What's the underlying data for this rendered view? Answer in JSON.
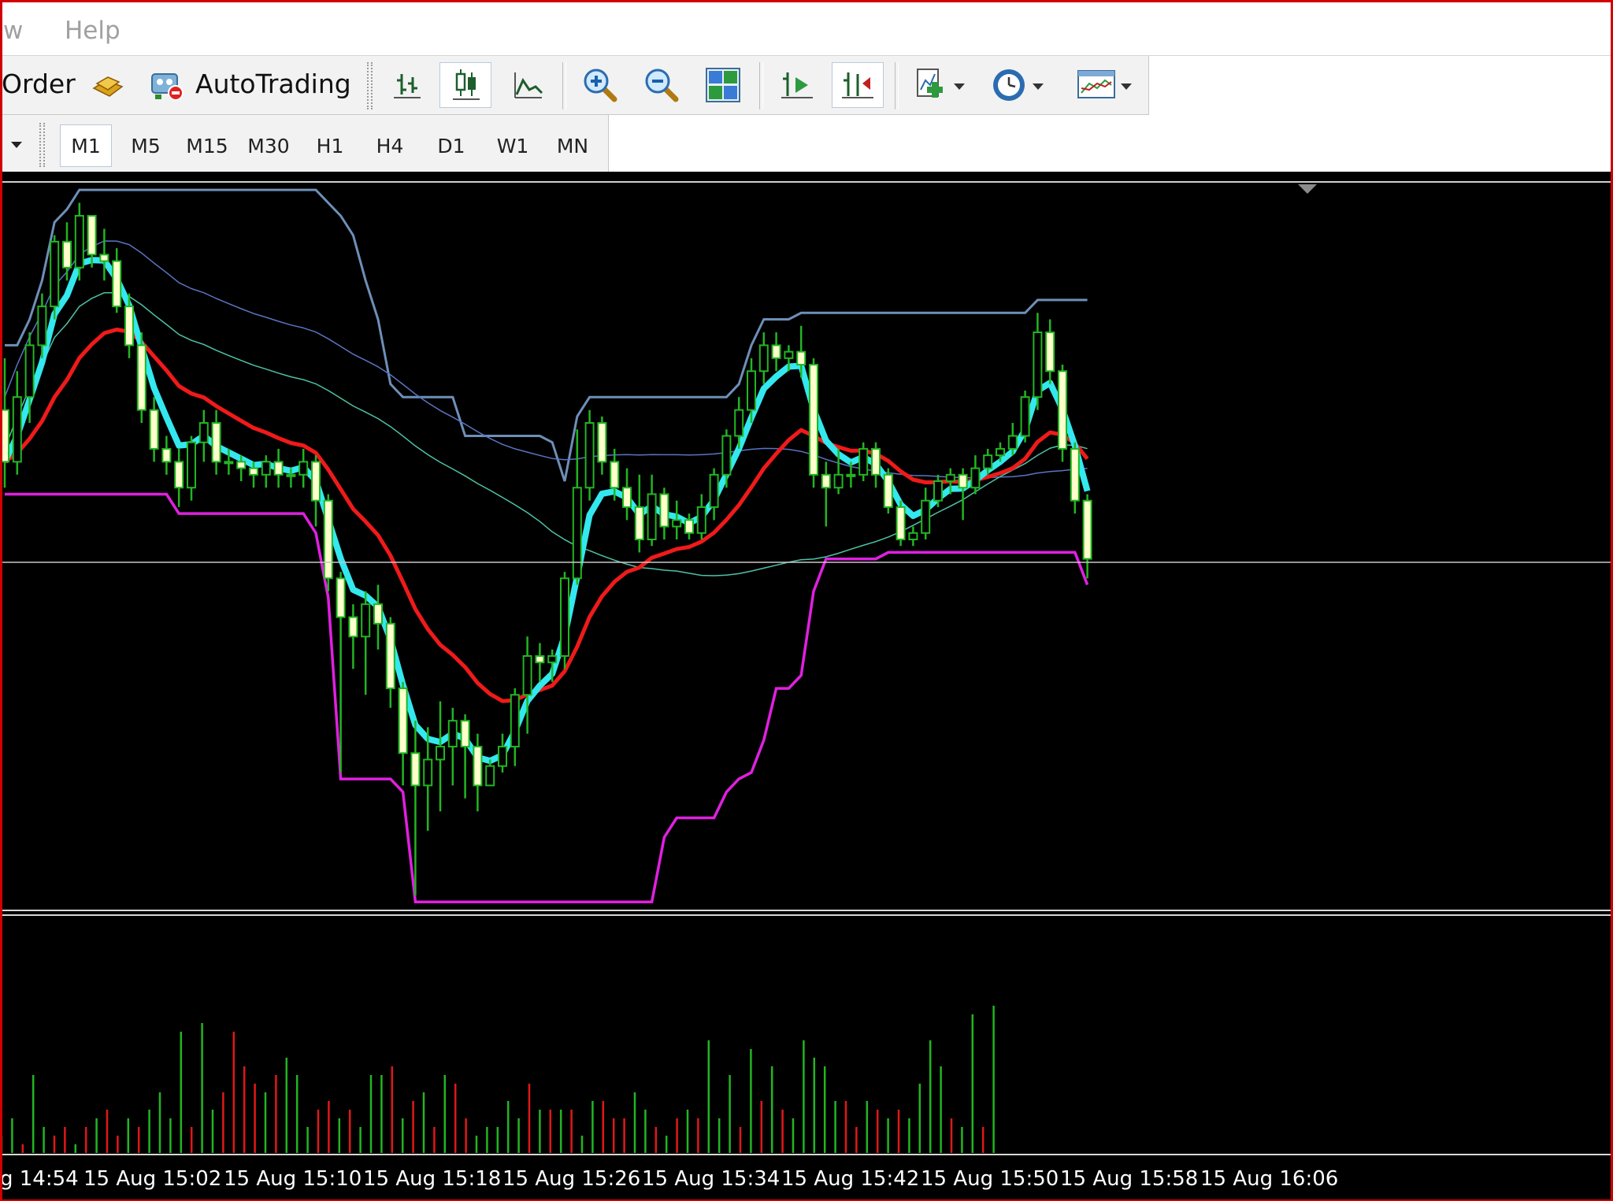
{
  "menu": {
    "items": [
      "w",
      "Help"
    ]
  },
  "toolbar": {
    "new_order_label": "Order",
    "autotrading_label": "AutoTrading"
  },
  "timeframes": [
    "M1",
    "M5",
    "M15",
    "M30",
    "H1",
    "H4",
    "D1",
    "W1",
    "MN"
  ],
  "active_timeframe": "M1",
  "icons": {
    "expert": "gold-bars-icon",
    "autotrading": "autotrading-icon",
    "bar_chart": "bar-chart-icon",
    "candlesticks": "candlesticks-icon",
    "line_chart": "line-chart-icon",
    "zoom_in": "zoom-in-icon",
    "zoom_out": "zoom-out-icon",
    "tile_windows": "tile-windows-icon",
    "autoscroll": "autoscroll-icon",
    "chart_shift": "chart-shift-icon",
    "indicators": "add-indicator-icon",
    "periods": "clock-icon",
    "templates": "templates-icon"
  },
  "colors": {
    "background": "#000000",
    "candle_body": "#ffffcc",
    "wick_and_volume_up": "#22b522",
    "volume_down": "#e01818",
    "ma_fast": "#33e8ee",
    "ma_slow": "#f01a1a",
    "upper_channel": "#6e8fb8",
    "lower_channel": "#e020e0",
    "mid_lines": "#5a74c2",
    "mid_lines_2": "#4fc2a6",
    "horizontal_line": "#c8c8c8"
  },
  "time_axis": {
    "labels": [
      "g 14:54",
      "15 Aug 15:02",
      "15 Aug 15:10",
      "15 Aug 15:18",
      "15 Aug 15:26",
      "15 Aug 15:34",
      "15 Aug 15:42",
      "15 Aug 15:50",
      "15 Aug 15:58",
      "15 Aug 16:06"
    ]
  },
  "series": {
    "candles_rel": [
      [
        0.7,
        0.62,
        0.78,
        0.58
      ],
      [
        0.62,
        0.72,
        0.76,
        0.6
      ],
      [
        0.72,
        0.8,
        0.82,
        0.68
      ],
      [
        0.8,
        0.86,
        0.88,
        0.78
      ],
      [
        0.86,
        0.96,
        0.97,
        0.84
      ],
      [
        0.96,
        0.92,
        0.99,
        0.9
      ],
      [
        0.92,
        1.0,
        1.02,
        0.9
      ],
      [
        1.0,
        0.94,
        1.0,
        0.92
      ],
      [
        0.94,
        0.93,
        0.98,
        0.9
      ],
      [
        0.93,
        0.86,
        0.95,
        0.85
      ],
      [
        0.86,
        0.8,
        0.88,
        0.78
      ],
      [
        0.8,
        0.7,
        0.82,
        0.68
      ],
      [
        0.7,
        0.64,
        0.72,
        0.62
      ],
      [
        0.64,
        0.62,
        0.66,
        0.6
      ],
      [
        0.62,
        0.58,
        0.64,
        0.55
      ],
      [
        0.58,
        0.65,
        0.66,
        0.56
      ],
      [
        0.65,
        0.68,
        0.7,
        0.62
      ],
      [
        0.68,
        0.62,
        0.7,
        0.6
      ],
      [
        0.62,
        0.62,
        0.64,
        0.6
      ],
      [
        0.62,
        0.61,
        0.63,
        0.59
      ],
      [
        0.61,
        0.6,
        0.62,
        0.58
      ],
      [
        0.6,
        0.62,
        0.63,
        0.58
      ],
      [
        0.62,
        0.6,
        0.64,
        0.58
      ],
      [
        0.6,
        0.6,
        0.61,
        0.58
      ],
      [
        0.6,
        0.62,
        0.64,
        0.58
      ],
      [
        0.62,
        0.56,
        0.63,
        0.52
      ],
      [
        0.56,
        0.44,
        0.57,
        0.42
      ],
      [
        0.44,
        0.38,
        0.45,
        0.14
      ],
      [
        0.38,
        0.35,
        0.4,
        0.3
      ],
      [
        0.35,
        0.4,
        0.42,
        0.26
      ],
      [
        0.4,
        0.37,
        0.43,
        0.33
      ],
      [
        0.37,
        0.27,
        0.38,
        0.24
      ],
      [
        0.27,
        0.17,
        0.28,
        0.12
      ],
      [
        0.17,
        0.12,
        0.22,
        -0.05
      ],
      [
        0.12,
        0.16,
        0.21,
        0.05
      ],
      [
        0.16,
        0.18,
        0.25,
        0.08
      ],
      [
        0.18,
        0.22,
        0.24,
        0.12
      ],
      [
        0.22,
        0.18,
        0.23,
        0.1
      ],
      [
        0.18,
        0.12,
        0.2,
        0.08
      ],
      [
        0.12,
        0.15,
        0.16,
        0.12
      ],
      [
        0.15,
        0.18,
        0.2,
        0.14
      ],
      [
        0.18,
        0.26,
        0.27,
        0.15
      ],
      [
        0.26,
        0.32,
        0.35,
        0.2
      ],
      [
        0.32,
        0.31,
        0.34,
        0.28
      ],
      [
        0.31,
        0.32,
        0.33,
        0.28
      ],
      [
        0.32,
        0.44,
        0.45,
        0.3
      ],
      [
        0.44,
        0.58,
        0.67,
        0.43
      ],
      [
        0.58,
        0.68,
        0.7,
        0.56
      ],
      [
        0.68,
        0.62,
        0.69,
        0.6
      ],
      [
        0.62,
        0.58,
        0.64,
        0.56
      ],
      [
        0.58,
        0.55,
        0.61,
        0.53
      ],
      [
        0.55,
        0.5,
        0.6,
        0.48
      ],
      [
        0.5,
        0.57,
        0.6,
        0.49
      ],
      [
        0.57,
        0.52,
        0.58,
        0.5
      ],
      [
        0.52,
        0.53,
        0.56,
        0.5
      ],
      [
        0.53,
        0.51,
        0.54,
        0.5
      ],
      [
        0.51,
        0.55,
        0.57,
        0.5
      ],
      [
        0.55,
        0.6,
        0.61,
        0.53
      ],
      [
        0.6,
        0.66,
        0.67,
        0.58
      ],
      [
        0.66,
        0.7,
        0.72,
        0.64
      ],
      [
        0.7,
        0.76,
        0.78,
        0.68
      ],
      [
        0.76,
        0.8,
        0.82,
        0.74
      ],
      [
        0.8,
        0.78,
        0.82,
        0.76
      ],
      [
        0.78,
        0.79,
        0.8,
        0.76
      ],
      [
        0.79,
        0.77,
        0.83,
        0.75
      ],
      [
        0.77,
        0.6,
        0.78,
        0.58
      ],
      [
        0.6,
        0.58,
        0.62,
        0.52
      ],
      [
        0.58,
        0.6,
        0.64,
        0.57
      ],
      [
        0.6,
        0.6,
        0.62,
        0.58
      ],
      [
        0.6,
        0.64,
        0.65,
        0.59
      ],
      [
        0.64,
        0.6,
        0.65,
        0.58
      ],
      [
        0.6,
        0.55,
        0.61,
        0.54
      ],
      [
        0.55,
        0.5,
        0.56,
        0.49
      ],
      [
        0.5,
        0.51,
        0.52,
        0.49
      ],
      [
        0.51,
        0.56,
        0.58,
        0.5
      ],
      [
        0.56,
        0.59,
        0.6,
        0.55
      ],
      [
        0.59,
        0.6,
        0.61,
        0.57
      ],
      [
        0.6,
        0.58,
        0.61,
        0.53
      ],
      [
        0.58,
        0.61,
        0.63,
        0.57
      ],
      [
        0.61,
        0.63,
        0.64,
        0.6
      ],
      [
        0.63,
        0.64,
        0.65,
        0.62
      ],
      [
        0.64,
        0.66,
        0.68,
        0.63
      ],
      [
        0.66,
        0.72,
        0.73,
        0.65
      ],
      [
        0.72,
        0.82,
        0.85,
        0.7
      ],
      [
        0.82,
        0.76,
        0.84,
        0.74
      ],
      [
        0.76,
        0.64,
        0.77,
        0.62
      ],
      [
        0.64,
        0.56,
        0.65,
        0.54
      ],
      [
        0.56,
        0.47,
        0.57,
        0.44
      ]
    ]
  },
  "volume": [
    2,
    4,
    1,
    9,
    3,
    2,
    3,
    1,
    3,
    4,
    5,
    2,
    4,
    3,
    5,
    7,
    4,
    14,
    3,
    15,
    5,
    7,
    14,
    10,
    8,
    7,
    9,
    11,
    9,
    3,
    5,
    6,
    4,
    5,
    3,
    9,
    9,
    10,
    4,
    6,
    7,
    3,
    9,
    8,
    4,
    2,
    3,
    3,
    6,
    4,
    8,
    5,
    5,
    5,
    5,
    2,
    6,
    6,
    4,
    4,
    7,
    5,
    3,
    2,
    4,
    5,
    4,
    13,
    4,
    9,
    3,
    12,
    6,
    10,
    5,
    4,
    13,
    11,
    10,
    6,
    6,
    3,
    6,
    5,
    4,
    5,
    4,
    8,
    13,
    10,
    4,
    3,
    16,
    3,
    17
  ],
  "volume_dir": [
    1,
    1,
    0,
    1,
    1,
    0,
    0,
    1,
    0,
    1,
    0,
    0,
    1,
    0,
    1,
    1,
    1,
    1,
    0,
    1,
    1,
    0,
    0,
    0,
    0,
    1,
    0,
    1,
    1,
    1,
    0,
    0,
    1,
    0,
    1,
    1,
    1,
    0,
    1,
    0,
    1,
    0,
    1,
    0,
    0,
    1,
    1,
    1,
    1,
    1,
    0,
    1,
    0,
    1,
    0,
    1,
    1,
    0,
    0,
    0,
    1,
    1,
    0,
    1,
    0,
    1,
    0,
    1,
    1,
    1,
    0,
    1,
    0,
    1,
    0,
    1,
    1,
    1,
    1,
    1,
    0,
    0,
    1,
    0,
    1,
    0,
    1,
    1,
    1,
    1,
    0,
    1,
    1,
    0,
    1
  ]
}
